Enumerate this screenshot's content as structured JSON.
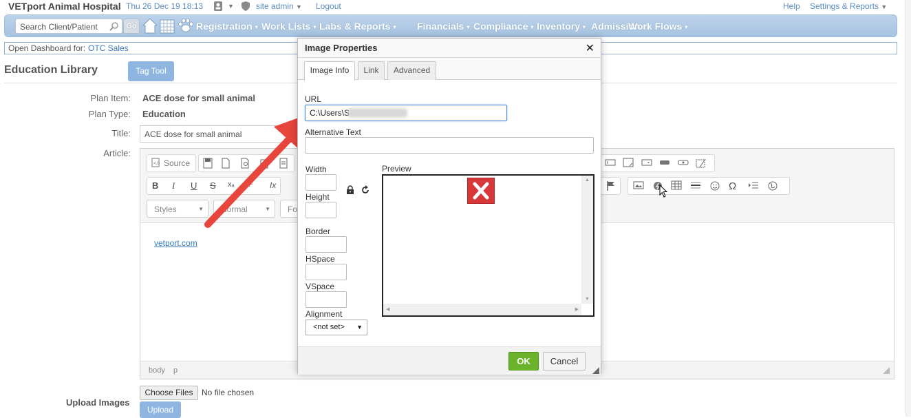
{
  "topbar": {
    "clinic_name": "VETport Animal Hospital",
    "datetime": "Thu 26 Dec 19 18:13",
    "user_menu": "site admin",
    "logout": "Logout",
    "help": "Help",
    "settings": "Settings & Reports"
  },
  "navbar": {
    "search_placeholder": "Search Client/Patient",
    "go": "Go",
    "items": [
      "Registration",
      "Work Lists",
      "Labs & Reports",
      "Financials",
      "Compliance",
      "Inventory",
      "Admission",
      "Work Flows"
    ]
  },
  "dashboard": {
    "label": "Open Dashboard for:",
    "value": "OTC Sales"
  },
  "page": {
    "title": "Education Library",
    "tag_tool": "Tag Tool",
    "plan_item_label": "Plan Item:",
    "plan_item_value": "ACE dose for small animal",
    "plan_type_label": "Plan Type:",
    "plan_type_value": "Education",
    "title_label": "Title:",
    "title_value": "ACE dose for small animal",
    "article_label": "Article:",
    "upload_label": "Upload Images",
    "choose_files": "Choose Files",
    "no_file": "No file chosen",
    "upload_button": "Upload"
  },
  "editor": {
    "source": "Source",
    "bold": "B",
    "italic": "I",
    "underline": "U",
    "strike": "S",
    "subscript": "xₐ",
    "superscript": "x²",
    "remove_format": "Ix",
    "styles": "Styles",
    "format": "Normal",
    "font": "Fo",
    "body_link": "vetport.com",
    "path_body": "body",
    "path_p": "p"
  },
  "dialog": {
    "title": "Image Properties",
    "tabs": [
      "Image Info",
      "Link",
      "Advanced"
    ],
    "url_label": "URL",
    "url_value": "C:\\Users\\S",
    "alt_label": "Alternative Text",
    "width_label": "Width",
    "height_label": "Height",
    "border_label": "Border",
    "hspace_label": "HSpace",
    "vspace_label": "VSpace",
    "alignment_label": "Alignment",
    "alignment_value": "<not set>",
    "preview_label": "Preview",
    "ok": "OK",
    "cancel": "Cancel"
  },
  "colors": {
    "accent_link": "#3c79b8",
    "nav_bar": "#a6c3e0",
    "ok_green": "#6ab32a",
    "arrow_red": "#e8453c"
  }
}
